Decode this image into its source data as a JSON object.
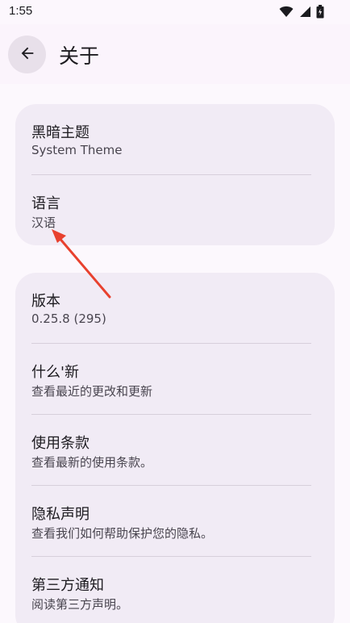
{
  "status_bar": {
    "time": "1:55",
    "icons": [
      "wifi-icon",
      "signal-icon",
      "battery-icon"
    ]
  },
  "app_bar": {
    "back_icon": "arrow-left-icon",
    "title": "关于"
  },
  "settings_group_1": [
    {
      "title": "黑暗主题",
      "subtitle": "System Theme"
    },
    {
      "title": "语言",
      "subtitle": "汉语"
    }
  ],
  "settings_group_2": [
    {
      "title": "版本",
      "subtitle": "0.25.8 (295)"
    },
    {
      "title": "什么'新",
      "subtitle": "查看最近的更改和更新"
    },
    {
      "title": "使用条款",
      "subtitle": "查看最新的使用条款。"
    },
    {
      "title": "隐私声明",
      "subtitle": "查看我们如何帮助保护您的隐私。"
    },
    {
      "title": "第三方通知",
      "subtitle": "阅读第三方声明。"
    }
  ],
  "colors": {
    "background": "#fcf8fd",
    "card": "#f1ebf5",
    "annotation_arrow": "#e8412e"
  }
}
